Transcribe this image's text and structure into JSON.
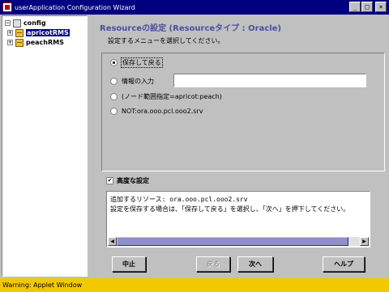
{
  "window": {
    "title": "userApplication Configuration Wizard",
    "controls": {
      "minimize": "_",
      "maximize": "□",
      "close": "×"
    }
  },
  "tree": {
    "root": {
      "label": "config",
      "toggle": "−"
    },
    "items": [
      {
        "label": "apricotRMS",
        "toggle": "+",
        "selected": true
      },
      {
        "label": "peachRMS",
        "toggle": "+",
        "selected": false
      }
    ]
  },
  "main": {
    "heading": "Resourceの設定 (Resourceタイプ : Oracle)",
    "subheading": "設定するメニューを選択してください。",
    "options": [
      {
        "label": "保存して戻る",
        "selected": true
      },
      {
        "label": "情報の入力",
        "selected": false
      },
      {
        "label": "(ノード範囲指定=apricot:peach)",
        "selected": false
      },
      {
        "label": "NOT:ora.ooo.pcl.ooo2.srv",
        "selected": false
      }
    ],
    "info_input_value": "",
    "advanced": {
      "label": "高度な設定",
      "checked": true,
      "mark": "✔"
    },
    "info_lines": [
      "追加するリソース: ora.ooo.pcl.ooo2.srv",
      "設定を保存する場合は、「保存して戻る」を選択し、「次へ」を押下してください。"
    ],
    "scroll": {
      "left_arrow": "◀",
      "right_arrow": "▶"
    }
  },
  "buttons": {
    "cancel": "中止",
    "back": "戻る",
    "next": "次へ",
    "help": "ヘルプ"
  },
  "status": "Warning: Applet Window"
}
